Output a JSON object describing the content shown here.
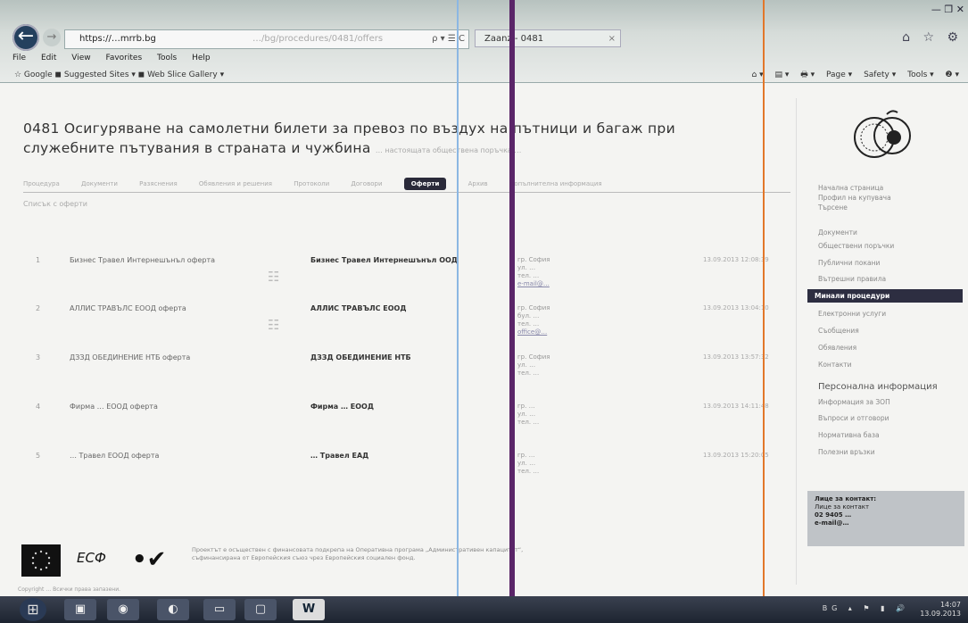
{
  "browser": {
    "url": "https://…mrrb.bg",
    "url_faded": "…/bg/procedures/0481/offers",
    "address_controls": "ρ ▾ ☰ C",
    "tab_label": "Zaanz - 0481",
    "tab_close": "×",
    "window_controls": "— ❐ ✕",
    "home_icons": "⌂ ☆ ⚙",
    "menu": [
      "File",
      "Edit",
      "View",
      "Favorites",
      "Tools",
      "Help"
    ],
    "favorites_left": "☆ Google  ◼ Suggested Sites ▾  ◼ Web Slice Gallery ▾",
    "commands": [
      "⌂ ▾",
      "▤ ▾",
      "🖶 ▾",
      "Page ▾",
      "Safety ▾",
      "Tools ▾",
      "❷ ▾"
    ]
  },
  "page": {
    "title": "0481 Осигуряване на самолетни билети за превоз по въздух на пътници и багаж при служебните пътувания в страната и чужбина",
    "title_sub": "… настоящата обществена поръчка …",
    "proc_nav": [
      "Процедура",
      "Документи",
      "Разяснения",
      "Обявления и решения",
      "Протоколи",
      "Договори",
      "Оферти",
      "Архив",
      "Допълнителна информация"
    ],
    "proc_nav_active": "Оферти",
    "section_label": "Списък с оферти"
  },
  "offers": [
    {
      "num": "1",
      "name": "Бизнес Травел Интернешънъл оферта",
      "company": "Бизнес Травел Интернешънъл ООД",
      "contact": [
        "гр. София",
        "ул. …",
        "тел. …"
      ],
      "contact_link": "e-mail@…",
      "date": "13.09.2013 12:08:39"
    },
    {
      "num": "2",
      "name": "АЛЛИС ТРАВЪЛС ЕООД оферта",
      "company": "АЛЛИС ТРАВЪЛС ЕООД",
      "contact": [
        "гр. София",
        "бул. …",
        "тел. …"
      ],
      "contact_link": "office@…",
      "date": "13.09.2013 13:04:10"
    },
    {
      "num": "3",
      "name": "ДЗЗД ОБЕДИНЕНИЕ НТБ оферта",
      "company": "ДЗЗД ОБЕДИНЕНИЕ НТБ",
      "contact": [
        "гр. София",
        "ул. …",
        "тел. …"
      ],
      "contact_link": "",
      "date": "13.09.2013 13:57:32"
    },
    {
      "num": "4",
      "name": "Фирма … ЕООД оферта",
      "company": "Фирма … ЕООД",
      "contact": [
        "гр. …",
        "ул. …",
        "тел. …"
      ],
      "contact_link": "",
      "date": "13.09.2013 14:11:48"
    },
    {
      "num": "5",
      "name": "… Травел ЕООД оферта",
      "company": "… Травел ЕАД",
      "contact": [
        "гр. …",
        "ул. …",
        "тел. …"
      ],
      "contact_link": "",
      "date": "13.09.2013 15:20:05"
    }
  ],
  "sidebar": {
    "top_links": [
      "Начална страница",
      "Профил на купувача",
      "Търсене"
    ],
    "links_1": [
      "Документи",
      "Обществени поръчки",
      "Публични покани",
      "Вътрешни правила"
    ],
    "active": "Минали процедури",
    "links_2": [
      "Електронни услуги",
      "Съобщения",
      "Обявления",
      "Контакти"
    ],
    "heading": "Персонална информация",
    "links_3": [
      "Информация за ЗОП",
      "Въпроси и отговори",
      "Нормативна база",
      "Полезни връзки"
    ],
    "contact_title": "Лице за контакт:",
    "contact_name": "Лице за контакт",
    "contact_phone": "02 9405 …",
    "contact_email": "e-mail@…"
  },
  "footer": {
    "esf": "ЕСФ",
    "text": "Проектът е осъществен с финансовата подкрепа на Оперативна програма „Административен капацитет“, съфинансирана от Европейския съюз чрез Европейския социален фонд.",
    "bottom": "Copyright … Всички права запазени."
  },
  "taskbar": {
    "apps": [
      "▣",
      "◉",
      "◐",
      "▭",
      "▢",
      "W"
    ],
    "time": "14:07",
    "date": "13.09.2013",
    "tray": "BG ▴ ⚑ ▮ 🔊"
  },
  "colors": {
    "nav_active": "#2d2e41",
    "taskbar": "#1d2430",
    "line_blue": "#6aa0d8",
    "line_purple": "#5a2568",
    "line_orange": "#e2772a"
  }
}
